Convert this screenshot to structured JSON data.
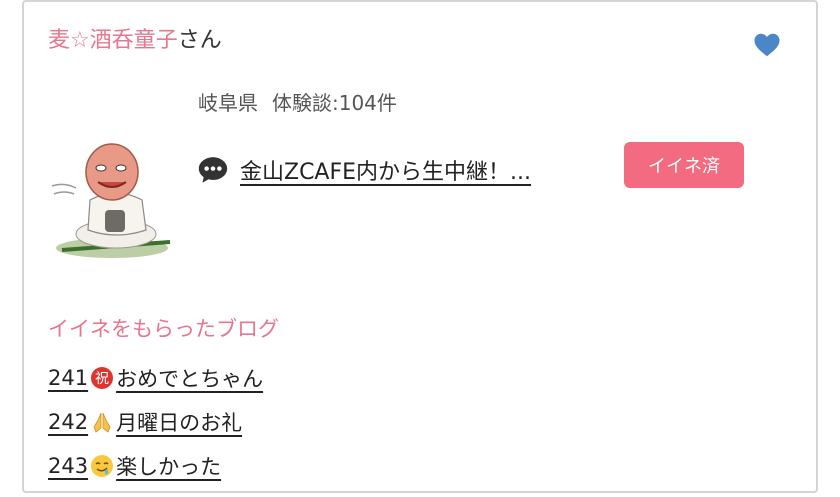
{
  "user": {
    "name": "麦☆酒呑童子",
    "honorific": "さん"
  },
  "profile": {
    "prefecture": "岐阜県",
    "reviews": "体験談:104件"
  },
  "latest_post": {
    "title": "金山ZCAFE内から生中継！..."
  },
  "like_button": {
    "label": "イイネ済"
  },
  "liked_blogs": {
    "heading": "イイネをもらったブログ",
    "items": [
      {
        "number": "241",
        "emoji": "congratulations-icon",
        "title": "おめでとちゃん"
      },
      {
        "number": "242",
        "emoji": "folded-hands-icon",
        "title": "月曜日のお礼"
      },
      {
        "number": "243",
        "emoji": "drooling-face-icon",
        "title": "楽しかった"
      }
    ]
  },
  "colors": {
    "accent_pink": "#e9758f",
    "button_pink": "#f36b80",
    "heart_blue": "#4a86c8"
  }
}
